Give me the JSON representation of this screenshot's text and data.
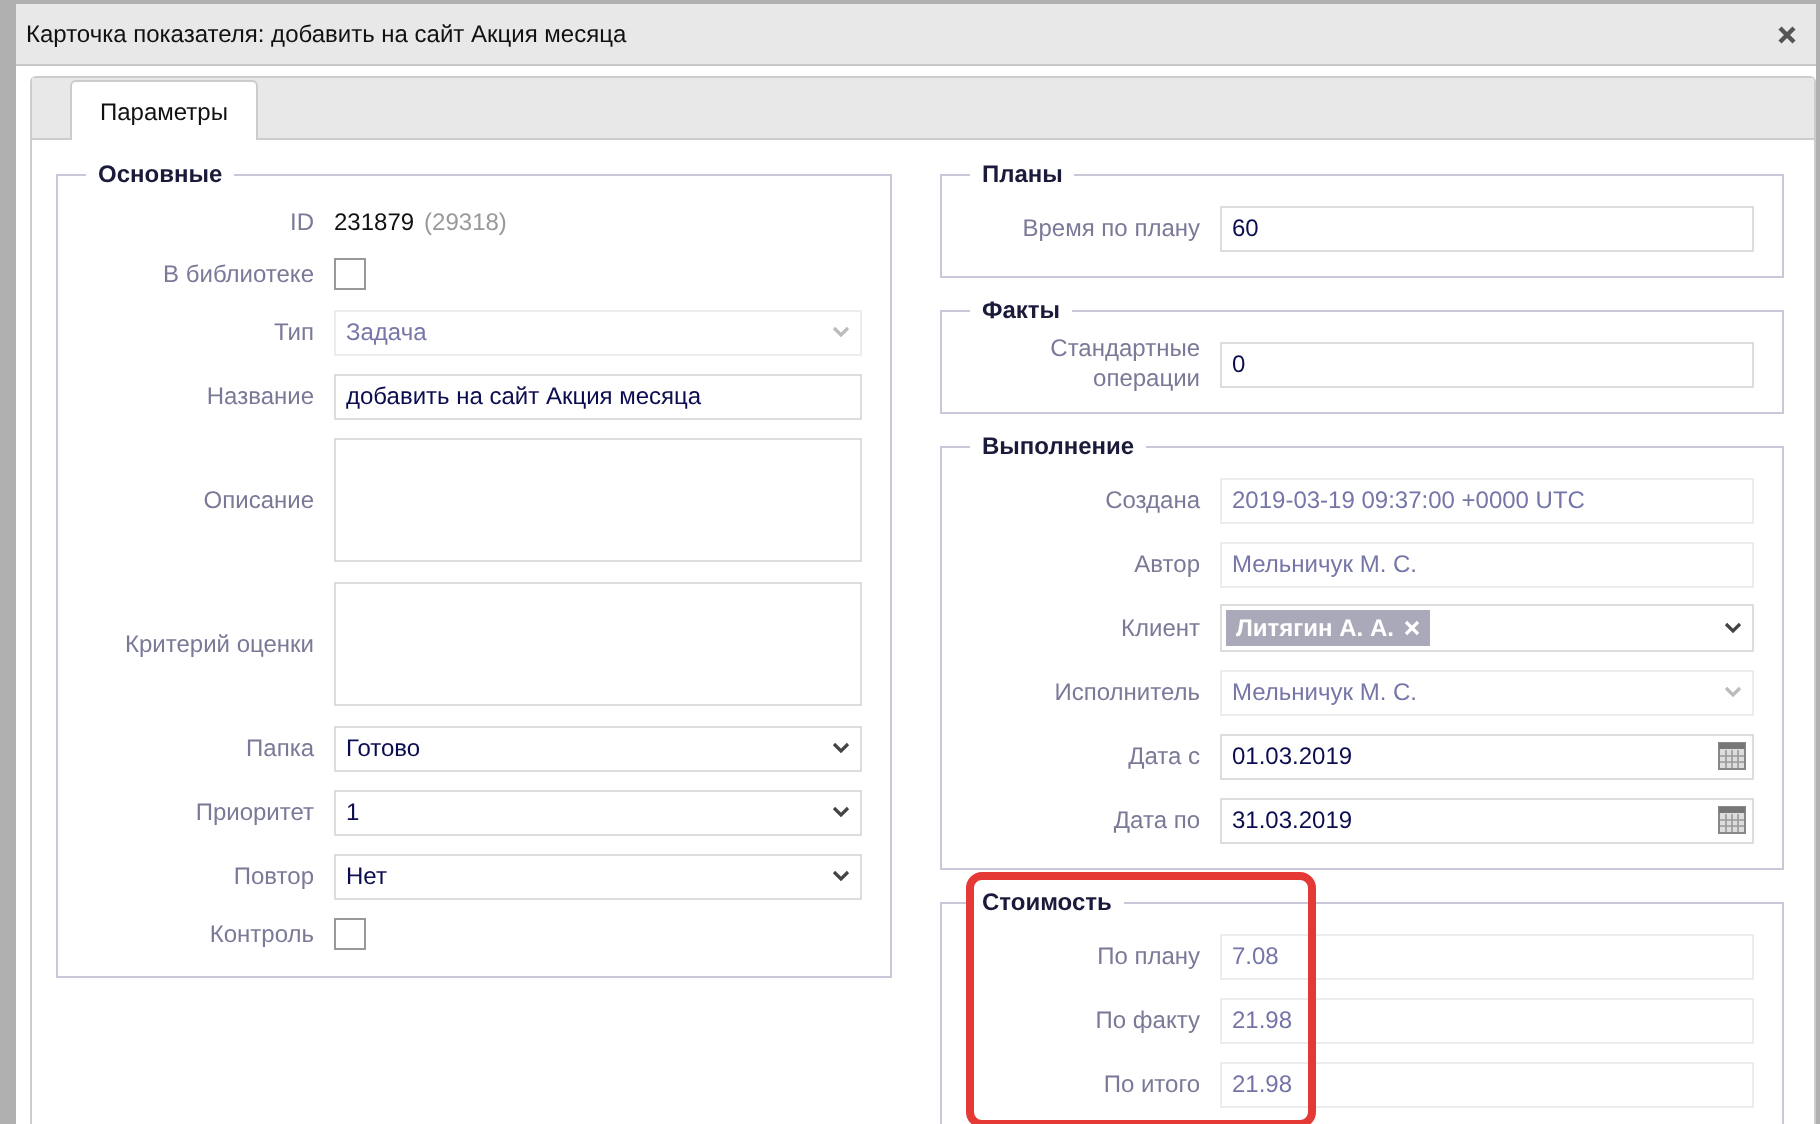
{
  "window": {
    "title": "Карточка показателя: добавить на сайт Акция месяца"
  },
  "tabs": [
    {
      "label": "Параметры",
      "selected": true
    }
  ],
  "left_group": {
    "legend": "Основные",
    "fields": [
      {
        "kind": "id",
        "label": "ID",
        "value": "231879",
        "secondary": "(29318)"
      },
      {
        "kind": "checkbox",
        "label": "В библиотеке",
        "checked": false
      },
      {
        "kind": "select",
        "label": "Тип",
        "value": "Задача",
        "disabled": true
      },
      {
        "kind": "text",
        "label": "Название",
        "value": "добавить на сайт Акция месяца",
        "disabled": false
      },
      {
        "kind": "textarea",
        "label": "Описание"
      },
      {
        "kind": "textarea",
        "label": "Критерий оценки"
      },
      {
        "kind": "select",
        "label": "Папка",
        "value": "Готово",
        "disabled": false
      },
      {
        "kind": "select",
        "label": "Приоритет",
        "value": "1",
        "disabled": false
      },
      {
        "kind": "select",
        "label": "Повтор",
        "value": "Нет",
        "disabled": false
      },
      {
        "kind": "checkbox",
        "label": "Контроль",
        "checked": false
      }
    ]
  },
  "right_groups": [
    {
      "legend": "Планы",
      "fields": [
        {
          "kind": "text",
          "label": "Время по плану",
          "value": "60",
          "disabled": false
        }
      ]
    },
    {
      "legend": "Факты",
      "fields": [
        {
          "kind": "text",
          "label": "Стандартные операции",
          "value": "0",
          "disabled": false
        }
      ]
    },
    {
      "legend": "Выполнение",
      "fields": [
        {
          "kind": "text",
          "label": "Создана",
          "value": "2019-03-19 09:37:00 +0000 UTC",
          "disabled": true
        },
        {
          "kind": "text",
          "label": "Автор",
          "value": "Мельничук М. С.",
          "disabled": true
        },
        {
          "kind": "tags",
          "label": "Клиент",
          "tags": [
            "Литягин А. А."
          ]
        },
        {
          "kind": "select",
          "label": "Исполнитель",
          "value": "Мельничук М. С.",
          "disabled": true
        },
        {
          "kind": "date",
          "label": "Дата с",
          "value": "01.03.2019"
        },
        {
          "kind": "date",
          "label": "Дата по",
          "value": "31.03.2019"
        }
      ]
    },
    {
      "legend": "Стоимость",
      "highlighted": true,
      "fields": [
        {
          "kind": "text",
          "label": "По плану",
          "value": "7.08",
          "disabled": true
        },
        {
          "kind": "text",
          "label": "По факту",
          "value": "21.98",
          "disabled": true
        },
        {
          "kind": "text",
          "label": "По итого",
          "value": "21.98",
          "disabled": true
        }
      ]
    }
  ]
}
